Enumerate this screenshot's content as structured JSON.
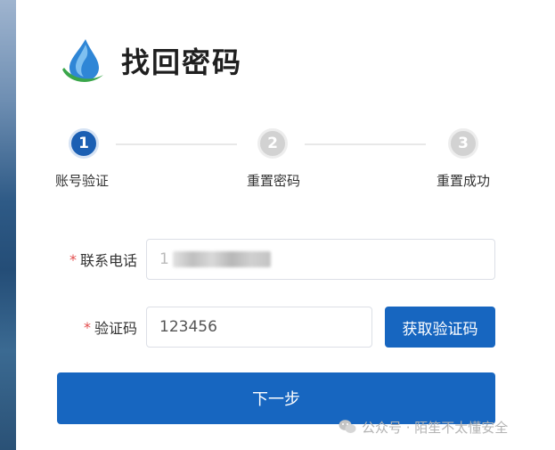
{
  "page": {
    "title": "找回密码"
  },
  "steps": [
    {
      "number": "1",
      "label": "账号验证",
      "state": "active"
    },
    {
      "number": "2",
      "label": "重置密码",
      "state": "inactive"
    },
    {
      "number": "3",
      "label": "重置成功",
      "state": "inactive"
    }
  ],
  "form": {
    "phone": {
      "required_mark": "*",
      "label": "联系电话",
      "value_prefix": "1"
    },
    "code": {
      "required_mark": "*",
      "label": "验证码",
      "value": "123456",
      "button_label": "获取验证码"
    }
  },
  "next_button": "下一步",
  "watermark": "公众号 · 陌笙不太懂安全",
  "colors": {
    "primary": "#1766c0",
    "required": "#e34d4d",
    "step_inactive": "#d2d2d2"
  },
  "icons": {
    "logo": "water-drop-logo-icon",
    "watermark": "wechat-icon"
  }
}
